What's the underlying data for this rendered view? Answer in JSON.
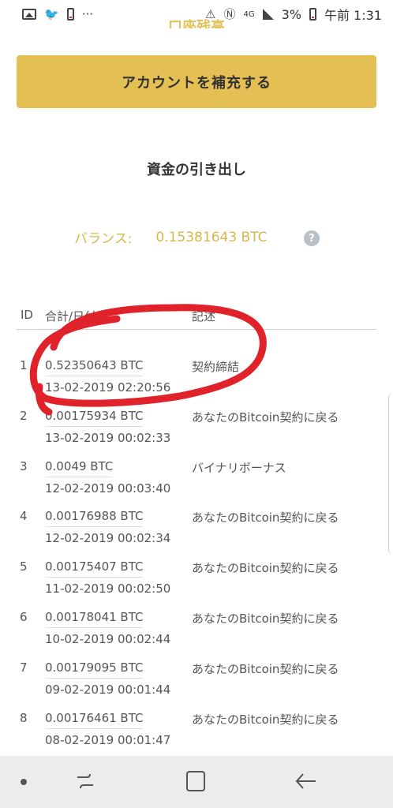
{
  "status_bar": {
    "left_icons": [
      "gallery-icon",
      "twitter-icon",
      "alert-battery-icon",
      "more-icon"
    ],
    "more_text": "···",
    "network": "4G",
    "battery_percent": "3%",
    "time": "午前 1:31"
  },
  "header": {
    "partial_title": "口座残高"
  },
  "actions": {
    "refill_label": "アカウントを補充する"
  },
  "withdraw": {
    "title": "資金の引き出し",
    "balance_label": "バランス:",
    "balance_value": "0.15381643 BTC",
    "help_symbol": "?"
  },
  "table": {
    "headers": {
      "id": "ID",
      "total": "合計/日付",
      "note": "記述"
    },
    "rows": [
      {
        "id": "1",
        "amount": "0.52350643 BTC",
        "date": "13-02-2019 02:20:56",
        "note": "契約締結"
      },
      {
        "id": "2",
        "amount": "0.00175934 BTC",
        "date": "13-02-2019 00:02:33",
        "note": "あなたのBitcoin契約に戻る"
      },
      {
        "id": "3",
        "amount": "0.0049 BTC",
        "date": "12-02-2019 00:03:40",
        "note": "バイナリボーナス"
      },
      {
        "id": "4",
        "amount": "0.00176988 BTC",
        "date": "12-02-2019 00:02:34",
        "note": "あなたのBitcoin契約に戻る"
      },
      {
        "id": "5",
        "amount": "0.00175407 BTC",
        "date": "11-02-2019 00:02:50",
        "note": "あなたのBitcoin契約に戻る"
      },
      {
        "id": "6",
        "amount": "0.00178041 BTC",
        "date": "10-02-2019 00:02:44",
        "note": "あなたのBitcoin契約に戻る"
      },
      {
        "id": "7",
        "amount": "0.00179095 BTC",
        "date": "09-02-2019 00:01:44",
        "note": "あなたのBitcoin契約に戻る"
      },
      {
        "id": "8",
        "amount": "0.00176461 BTC",
        "date": "08-02-2019 00:01:47",
        "note": "あなたのBitcoin契約に戻る"
      }
    ]
  },
  "colors": {
    "accent": "#e4c054",
    "balance_text": "#d8b84a",
    "annotation": "#e0222a"
  },
  "nav": {
    "icons": [
      "nav-dot-icon",
      "recent-apps-icon",
      "home-icon",
      "back-icon"
    ]
  }
}
